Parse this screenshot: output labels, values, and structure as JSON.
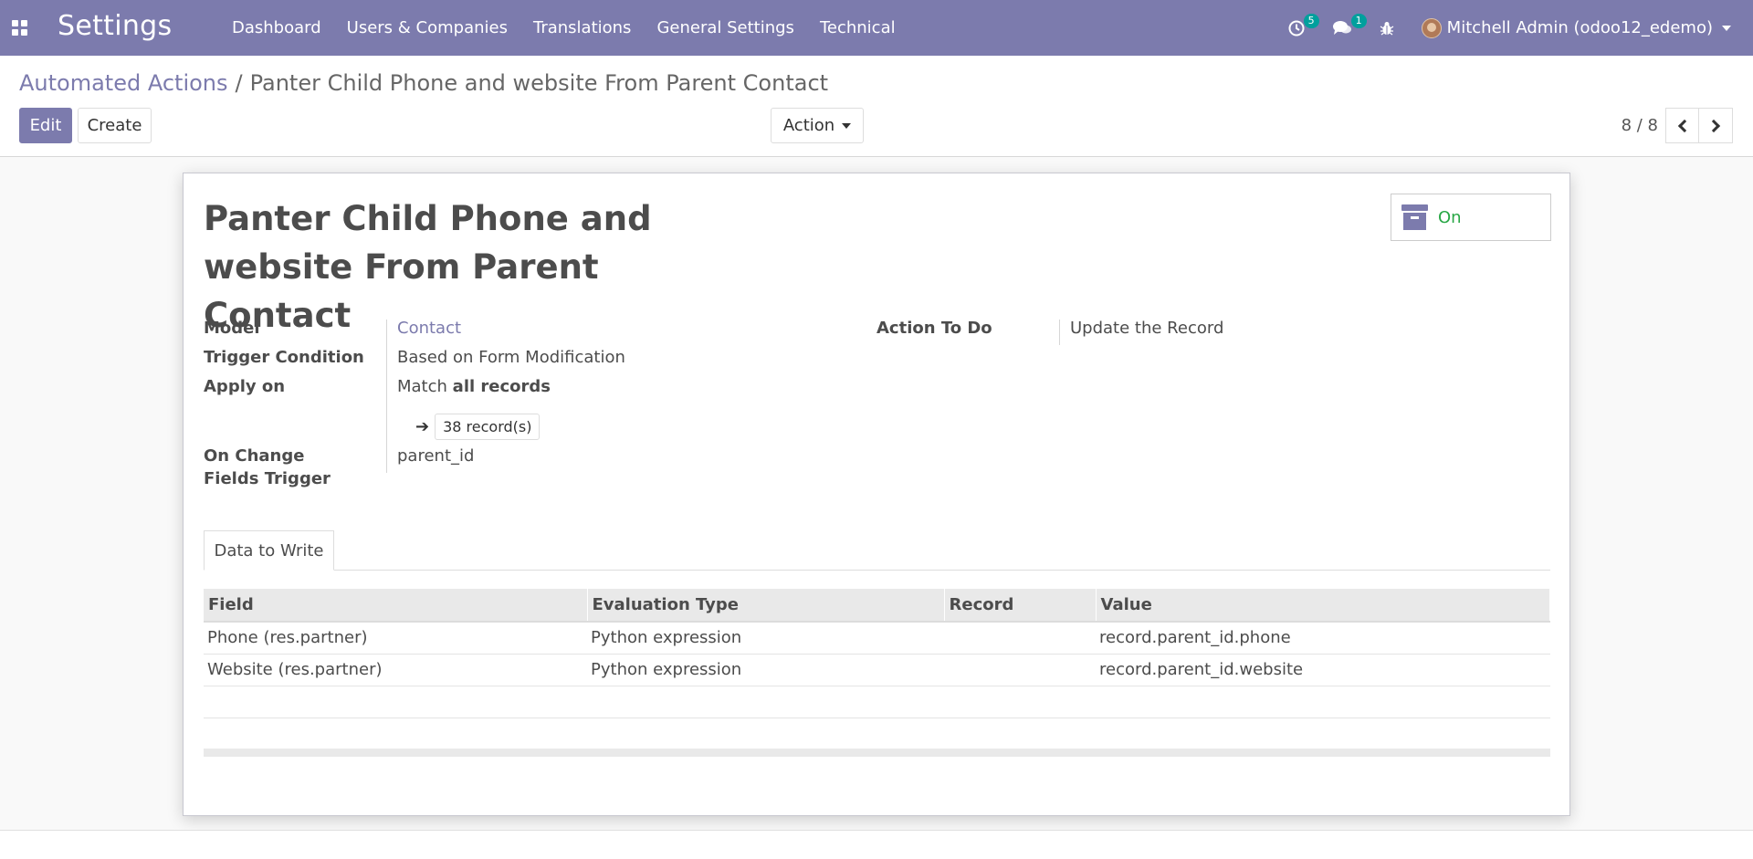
{
  "navbar": {
    "app_title": "Settings",
    "menu": [
      "Dashboard",
      "Users & Companies",
      "Translations",
      "General Settings",
      "Technical"
    ],
    "activity_badge": "5",
    "messages_badge": "1",
    "user": "Mitchell Admin (odoo12_edemo)"
  },
  "breadcrumb": {
    "parent": "Automated Actions",
    "separator": "/",
    "current": "Panter Child Phone and website From Parent Contact"
  },
  "buttons": {
    "edit": "Edit",
    "create": "Create",
    "action": "Action"
  },
  "pager": {
    "value": "8 / 8"
  },
  "record": {
    "title": "Panter Child Phone and website From Parent Contact",
    "active_label": "On",
    "fields": {
      "model_label": "Model",
      "model_value": "Contact",
      "trigger_label": "Trigger Condition",
      "trigger_value": "Based on Form Modification",
      "apply_label": "Apply on",
      "apply_prefix": "Match",
      "apply_value": "all records",
      "records_count": "38 record(s)",
      "onchange_label": "On Change Fields Trigger",
      "onchange_value": "parent_id",
      "action_label": "Action To Do",
      "action_value": "Update the Record"
    }
  },
  "tabs": [
    "Data to Write"
  ],
  "table": {
    "headers": [
      "Field",
      "Evaluation Type",
      "Record",
      "Value"
    ],
    "rows": [
      [
        "Phone (res.partner)",
        "Python expression",
        "",
        "record.parent_id.phone"
      ],
      [
        "Website (res.partner)",
        "Python expression",
        "",
        "record.parent_id.website"
      ]
    ]
  },
  "colors": {
    "brand": "#7c7bad",
    "active_green": "#28a745",
    "badge_teal": "#00a09d"
  },
  "icons": {
    "apps": "apps-grid-icon",
    "activity": "clock-icon",
    "messages": "comments-icon",
    "debug": "bug-icon",
    "archive": "archive-icon",
    "records_arrow": "arrow-right-icon"
  }
}
